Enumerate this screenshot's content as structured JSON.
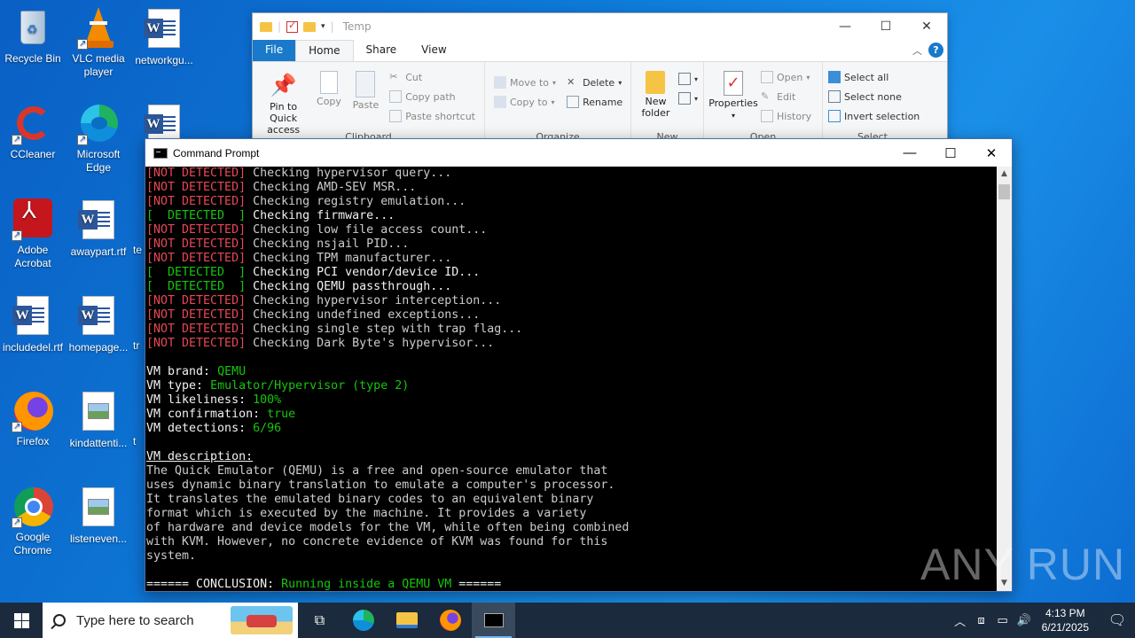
{
  "desktop": {
    "icons": [
      {
        "label": "Recycle Bin"
      },
      {
        "label": "VLC media player"
      },
      {
        "label": "networkgu..."
      },
      {
        "label": "CCleaner"
      },
      {
        "label": "Microsoft Edge"
      },
      {
        "label": "Adobe Acrobat"
      },
      {
        "label": "awaypart.rtf"
      },
      {
        "label": "te"
      },
      {
        "label": "includedel.rtf"
      },
      {
        "label": "homepage..."
      },
      {
        "label": "tr"
      },
      {
        "label": "Firefox"
      },
      {
        "label": "kindattenti..."
      },
      {
        "label": "t"
      },
      {
        "label": "Google Chrome"
      },
      {
        "label": "listeneven..."
      }
    ]
  },
  "explorer": {
    "title": "Temp",
    "tabs": {
      "file": "File",
      "home": "Home",
      "share": "Share",
      "view": "View"
    },
    "clipboard": {
      "group": "Clipboard",
      "pin": "Pin to Quick access",
      "copy": "Copy",
      "paste": "Paste",
      "cut": "Cut",
      "copy_path": "Copy path",
      "paste_shortcut": "Paste shortcut"
    },
    "organize": {
      "group": "Organize",
      "move_to": "Move to",
      "copy_to": "Copy to",
      "delete": "Delete",
      "rename": "Rename"
    },
    "new": {
      "group": "New",
      "new_folder": "New folder"
    },
    "open": {
      "group": "Open",
      "properties": "Properties",
      "open": "Open",
      "edit": "Edit",
      "history": "History"
    },
    "select": {
      "group": "Select",
      "select_all": "Select all",
      "select_none": "Select none",
      "invert": "Invert selection"
    }
  },
  "cmd": {
    "title": "Command Prompt",
    "checks": [
      {
        "status": "[NOT DETECTED]",
        "detected": false,
        "text": "Checking hypervisor query..."
      },
      {
        "status": "[NOT DETECTED]",
        "detected": false,
        "text": "Checking AMD-SEV MSR..."
      },
      {
        "status": "[NOT DETECTED]",
        "detected": false,
        "text": "Checking registry emulation..."
      },
      {
        "status": "[  DETECTED  ]",
        "detected": true,
        "text": "Checking firmware..."
      },
      {
        "status": "[NOT DETECTED]",
        "detected": false,
        "text": "Checking low file access count..."
      },
      {
        "status": "[NOT DETECTED]",
        "detected": false,
        "text": "Checking nsjail PID..."
      },
      {
        "status": "[NOT DETECTED]",
        "detected": false,
        "text": "Checking TPM manufacturer..."
      },
      {
        "status": "[  DETECTED  ]",
        "detected": true,
        "text": "Checking PCI vendor/device ID..."
      },
      {
        "status": "[  DETECTED  ]",
        "detected": true,
        "text": "Checking QEMU passthrough..."
      },
      {
        "status": "[NOT DETECTED]",
        "detected": false,
        "text": "Checking hypervisor interception..."
      },
      {
        "status": "[NOT DETECTED]",
        "detected": false,
        "text": "Checking undefined exceptions..."
      },
      {
        "status": "[NOT DETECTED]",
        "detected": false,
        "text": "Checking single step with trap flag..."
      },
      {
        "status": "[NOT DETECTED]",
        "detected": false,
        "text": "Checking Dark Byte's hypervisor..."
      }
    ],
    "summary": [
      {
        "key": "VM brand: ",
        "value": "QEMU"
      },
      {
        "key": "VM type: ",
        "value": "Emulator/Hypervisor (type 2)"
      },
      {
        "key": "VM likeliness: ",
        "value": "100%"
      },
      {
        "key": "VM confirmation: ",
        "value": "true"
      },
      {
        "key": "VM detections: ",
        "value": "6/96"
      }
    ],
    "description_heading": "VM description:",
    "description_lines": [
      "The Quick Emulator (QEMU) is a free and open-source emulator that",
      "uses dynamic binary translation to emulate a computer's processor.",
      "It translates the emulated binary codes to an equivalent binary",
      "format which is executed by the machine. It provides a variety",
      "of hardware and device models for the VM, while often being combined",
      "with KVM. However, no concrete evidence of KVM was found for this",
      "system."
    ],
    "conclusion_prefix": "====== CONCLUSION: ",
    "conclusion_value": "Running inside a QEMU VM",
    "conclusion_suffix": " ======"
  },
  "watermark": "ANY RUN",
  "taskbar": {
    "search_placeholder": "Type here to search",
    "time": "4:13 PM",
    "date": "6/21/2025"
  },
  "colors": {
    "not_detected": "#e74856",
    "detected": "#16c60c",
    "desktop": "#0e7ad8",
    "taskbar": "#1b2a3d"
  }
}
